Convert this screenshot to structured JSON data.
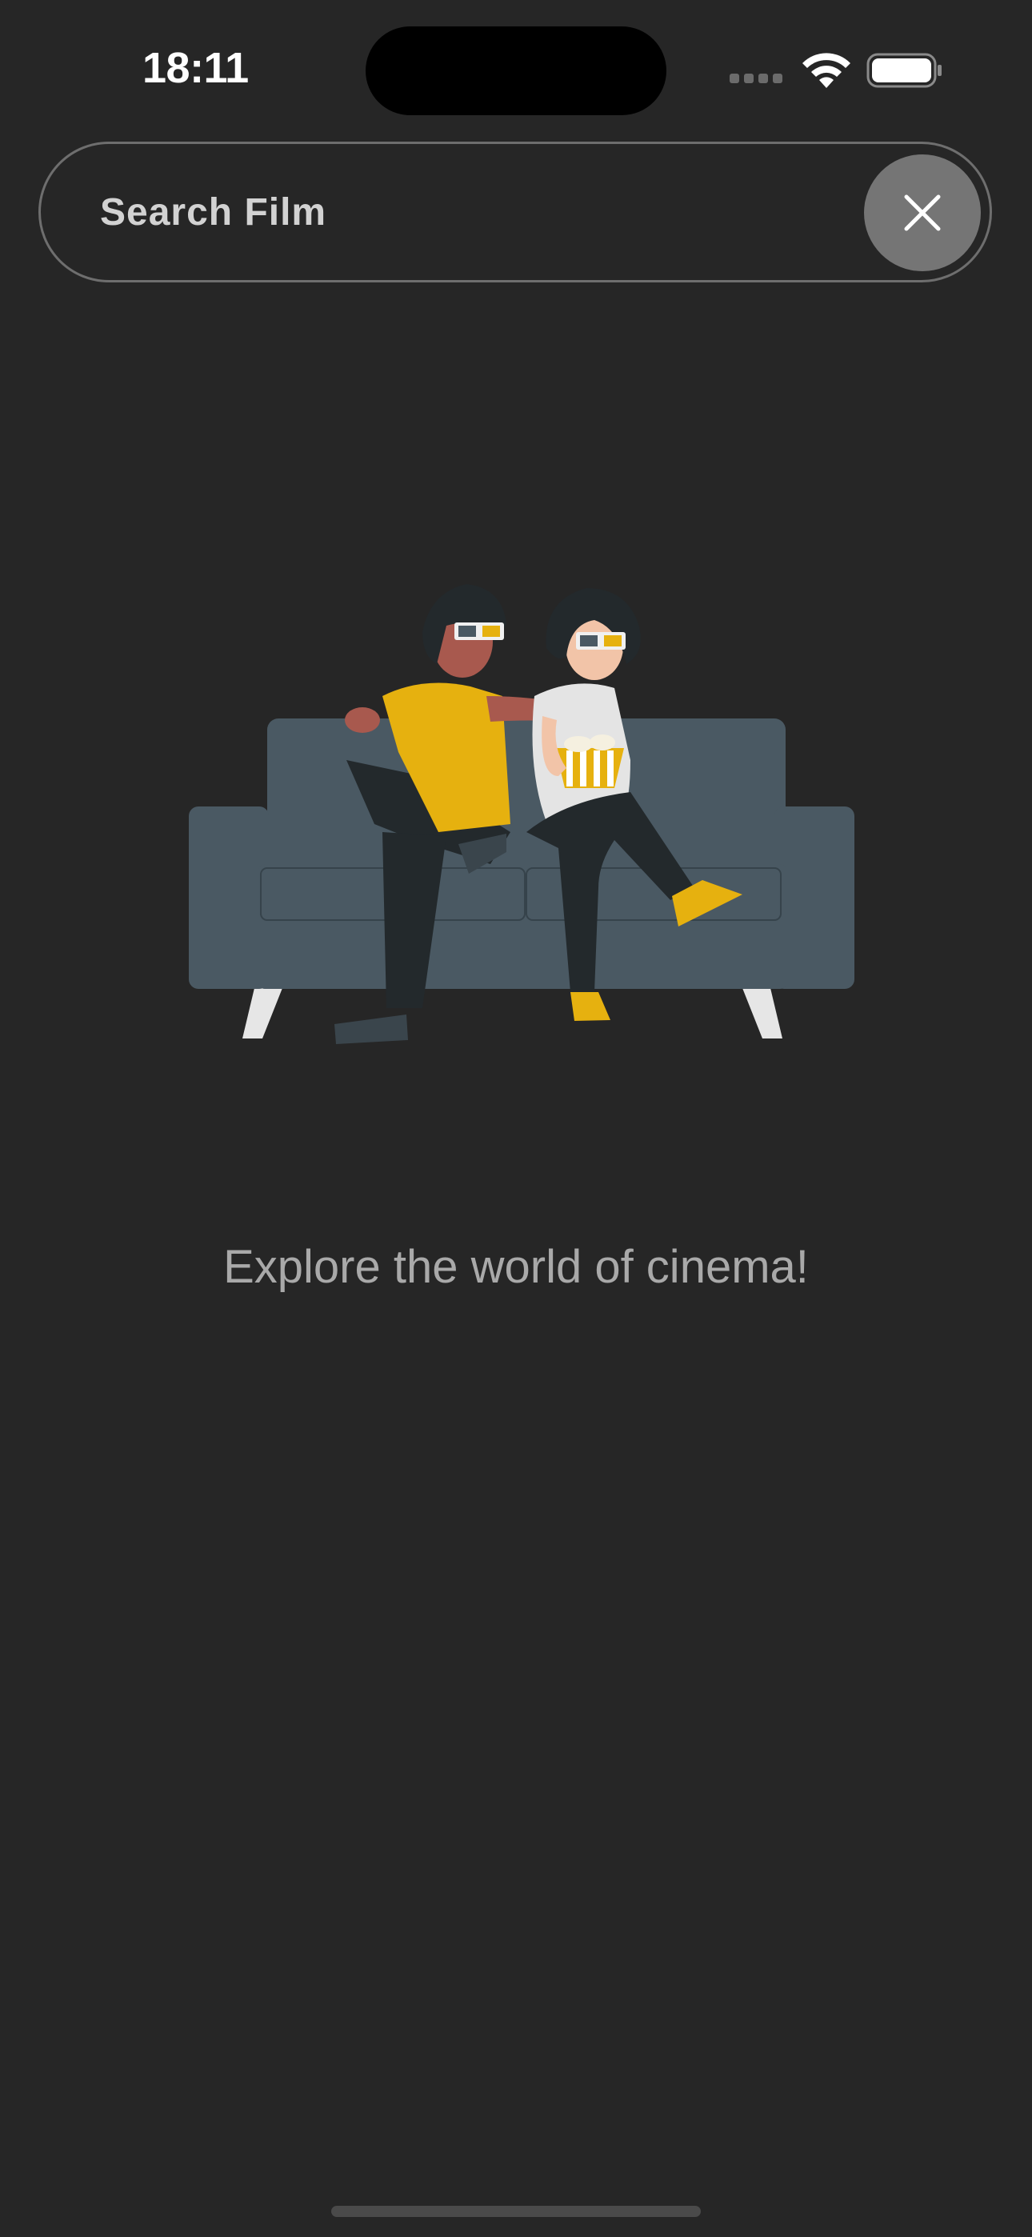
{
  "status_bar": {
    "time": "18:11",
    "icons": [
      "cellular-signal-icon",
      "wifi-icon",
      "battery-icon"
    ]
  },
  "search": {
    "placeholder": "Search Film",
    "value": "",
    "clear_icon": "close-icon"
  },
  "empty_state": {
    "illustration": "couple-watching-movie-on-sofa-illustration",
    "message": "Explore the world of cinema!"
  },
  "colors": {
    "background": "#262626",
    "search_border": "#6e6e6e",
    "clear_button": "#757575",
    "message_text": "#a9a9a9",
    "accent_yellow": "#e6b10f",
    "sofa": "#4a5963"
  }
}
